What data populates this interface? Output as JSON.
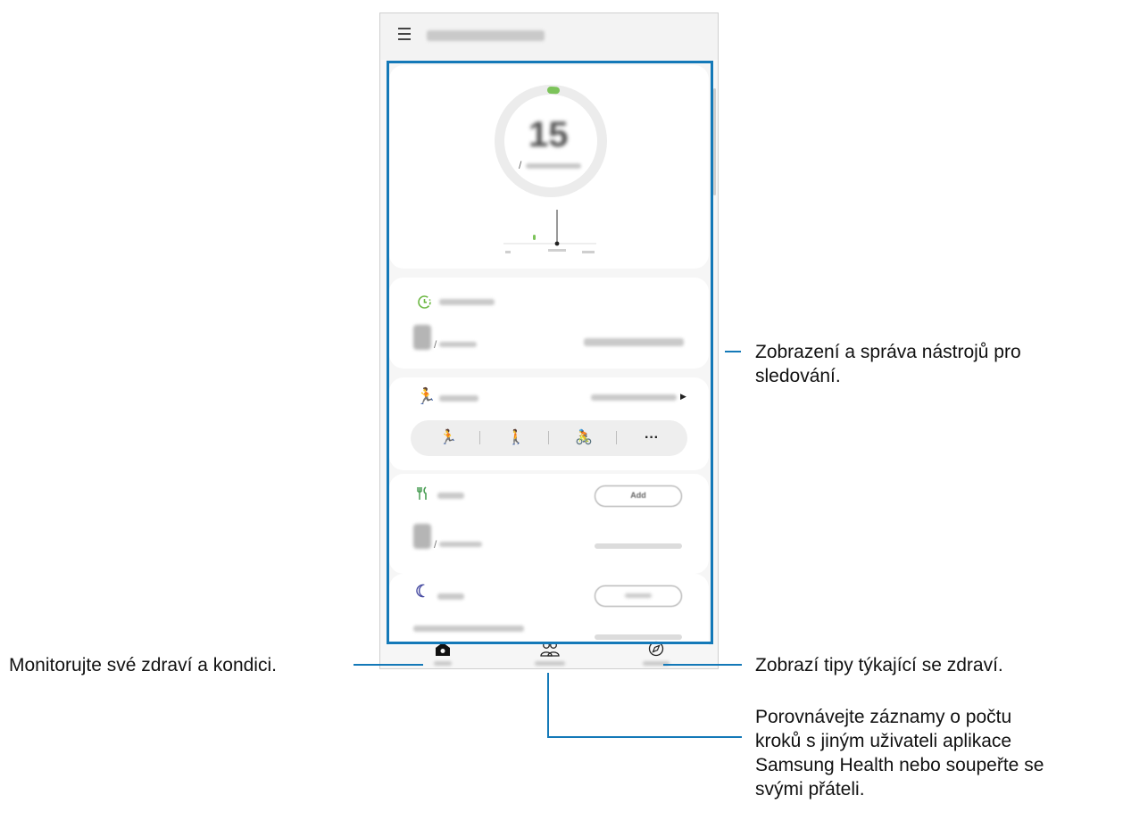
{
  "colors": {
    "accent_frame": "#1479b8",
    "leader_lines": "#1479b8",
    "steps_green": "#7cc35a",
    "exercise_green": "#5ab15a",
    "food_green": "#4a9e55",
    "sleep_indigo": "#4b4fa3"
  },
  "app_bar": {
    "menu_icon": "hamburger-menu-icon",
    "title": ""
  },
  "steps_card": {
    "value": "15",
    "separator": "/",
    "goal": ""
  },
  "active_time_card": {
    "icon": "timer-icon",
    "title": "",
    "value": "",
    "separator": "/"
  },
  "exercise_card": {
    "icon": "running-icon",
    "title": "",
    "link": "",
    "activities": [
      {
        "icon": "running-icon",
        "glyph": "🏃"
      },
      {
        "icon": "walking-icon",
        "glyph": "🚶"
      },
      {
        "icon": "cycling-icon",
        "glyph": "🚴"
      },
      {
        "icon": "more-icon",
        "glyph": "···"
      }
    ]
  },
  "food_card": {
    "icon": "fork-knife-icon",
    "title": "",
    "add_button": "Add",
    "separator": "/"
  },
  "sleep_card": {
    "icon": "moon-icon",
    "title": "",
    "button": "",
    "prompt": ""
  },
  "bottom_nav": [
    {
      "icon": "home-icon",
      "label": ""
    },
    {
      "icon": "people-icon",
      "label": ""
    },
    {
      "icon": "compass-icon",
      "label": ""
    }
  ],
  "callouts": {
    "trackers": "Zobrazení a správa nástrojů pro\nsledování.",
    "home": "Monitorujte své zdraví a kondici.",
    "discover": "Zobrazí tipy týkající se zdraví.",
    "together": "Porovnávejte záznamy o počtu\nkroků s jiným uživateli aplikace\nSamsung Health nebo soupeřte se\nsvými přáteli."
  }
}
